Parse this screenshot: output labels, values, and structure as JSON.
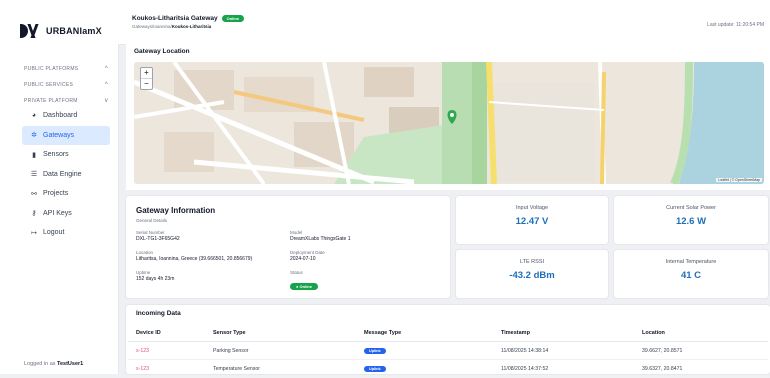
{
  "app": {
    "name": "URBANIamX"
  },
  "sidebar": {
    "sections": [
      {
        "label": "PUBLIC PLATFORMS",
        "chevron": "^"
      },
      {
        "label": "PUBLIC SERVICES",
        "chevron": "^"
      },
      {
        "label": "PRIVATE PLATFORM",
        "chevron": "v"
      }
    ],
    "items": [
      {
        "label": "Dashboard",
        "icon": "dashboard-icon"
      },
      {
        "label": "Gateways",
        "icon": "gateway-icon",
        "active": true
      },
      {
        "label": "Sensors",
        "icon": "sensor-icon"
      },
      {
        "label": "Data Engine",
        "icon": "database-icon"
      },
      {
        "label": "Projects",
        "icon": "projects-icon"
      },
      {
        "label": "API Keys",
        "icon": "key-icon"
      },
      {
        "label": "Logout",
        "icon": "logout-icon"
      }
    ],
    "logged_prefix": "Logged in as",
    "logged_user": "TestUser1"
  },
  "header": {
    "title": "Koukos-Litharitsia Gateway",
    "status": "Online",
    "breadcrumb_path": "Gateways/Ioannina/",
    "breadcrumb_current": "Koukos-Litharitsia",
    "last_update": "Last update: 11:20:54 PM"
  },
  "map_section": {
    "title": "Gateway Location",
    "zoom_in": "+",
    "zoom_out": "−",
    "attribution": "Leaflet | © OpenStreetMap"
  },
  "gateway_info": {
    "title": "Gateway Information",
    "subtitle": "General Details",
    "serial_label": "Serial Number",
    "serial_value": "DXL-TG1-3F65G42",
    "model_label": "Model",
    "model_value": "DreamXLabs ThingsGate 1",
    "location_label": "Location",
    "location_value": "Litharitsa, Ioannina, Greece (39.666501, 20.856679)",
    "deploy_label": "Deployment Date",
    "deploy_value": "2024-07-10",
    "uptime_label": "Uptime",
    "uptime_value": "152 days 4h 23m",
    "status_label": "Status",
    "status_value": "Online"
  },
  "metrics": [
    {
      "label": "Input Voltage",
      "value": "12.47 V"
    },
    {
      "label": "Current Solar Power",
      "value": "12.6 W"
    },
    {
      "label": "LTE RSSI",
      "value": "-43.2 dBm"
    },
    {
      "label": "Internal Temperature",
      "value": "41 C"
    }
  ],
  "incoming": {
    "title": "Incoming Data",
    "columns": [
      "Device ID",
      "Sensor Type",
      "Message Type",
      "Timestamp",
      "Location"
    ],
    "rows": [
      {
        "device": "s-123",
        "sensor": "Parking Sensor",
        "message": "Uplink",
        "timestamp": "11/08/2025 14:38:14",
        "location": "39.6627, 20.8571"
      },
      {
        "device": "s-123",
        "sensor": "Temperature Sensor",
        "message": "Uplink",
        "timestamp": "11/08/2025 14:37:52",
        "location": "39.6327, 20.8471"
      }
    ]
  },
  "colors": {
    "accent": "#2563eb",
    "online": "#16a34a",
    "metric": "#1e6fb8",
    "device": "#e0566f"
  }
}
